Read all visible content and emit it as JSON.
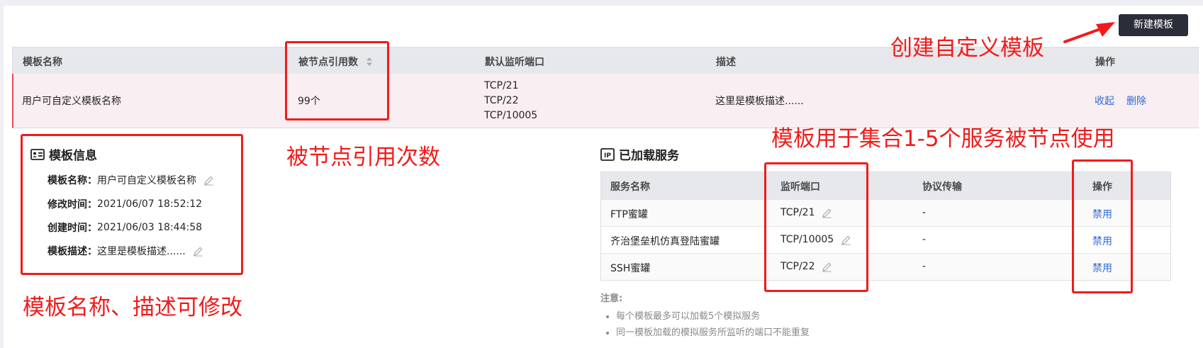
{
  "toolbar": {
    "new_template_label": "新建模板"
  },
  "template_table": {
    "headers": [
      "模板名称",
      "被节点引用数",
      "默认监听端口",
      "描述",
      "操作"
    ],
    "row": {
      "name": "用户可自定义模板名称",
      "ref_count": "99个",
      "ports": [
        "TCP/21",
        "TCP/22",
        "TCP/10005"
      ],
      "description": "这里是模板描述......",
      "actions": [
        "收起",
        "删除"
      ]
    }
  },
  "template_info": {
    "title": "模板信息",
    "fields": [
      {
        "label": "模板名称：",
        "value": "用户可自定义模板名称"
      },
      {
        "label": "修改时间：",
        "value": "2021/06/07 18:52:12"
      },
      {
        "label": "创建时间：",
        "value": "2021/06/03 18:44:58"
      },
      {
        "label": "模板描述：",
        "value": "这里是模板描述......"
      }
    ]
  },
  "loaded_services": {
    "title": "已加载服务",
    "headers": [
      "服务名称",
      "监听端口",
      "协议传输",
      "操作"
    ],
    "rows": [
      {
        "name": "FTP蜜罐",
        "port": "TCP/21",
        "protocol": "-",
        "action": "禁用"
      },
      {
        "name": "齐治堡垒机仿真登陆蜜罐",
        "port": "TCP/10005",
        "protocol": "-",
        "action": "禁用"
      },
      {
        "name": "SSH蜜罐",
        "port": "TCP/22",
        "protocol": "-",
        "action": "禁用"
      }
    ]
  },
  "notes": {
    "title": "注意:",
    "items": [
      "每个模板最多可以加载5个模拟服务",
      "同一模板加载的模拟服务所监听的端口不能重复"
    ]
  },
  "annotations": {
    "create_custom": "创建自定义模板",
    "ref_times": "被节点引用次数",
    "services_usage": "模板用于集合1-5个服务被节点使用",
    "editable": "模板名称、描述可修改"
  },
  "colors": {
    "accent": "#2f6ad9",
    "annotation": "#f01c1c",
    "button": "#2b2e38"
  }
}
